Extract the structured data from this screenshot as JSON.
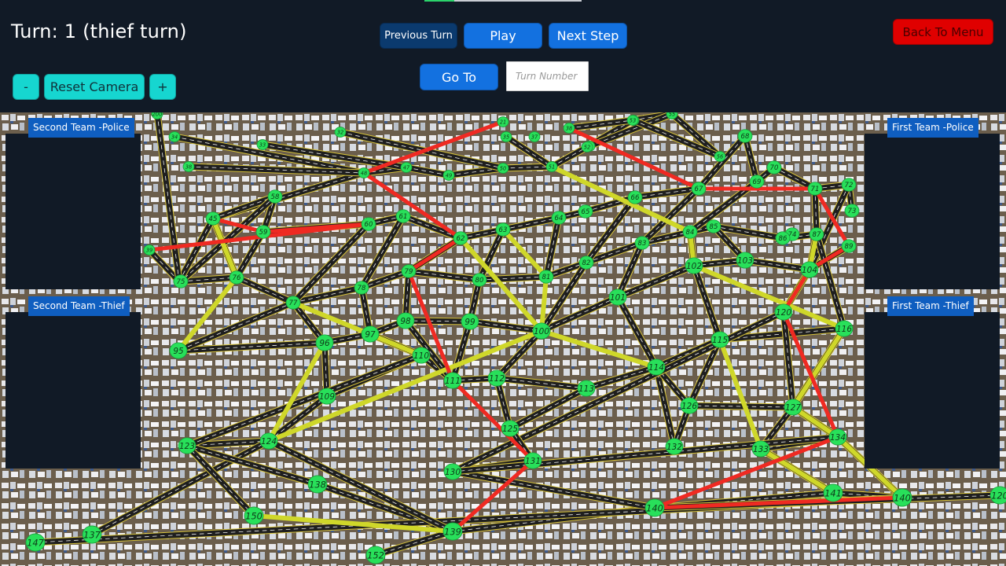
{
  "header": {
    "turn_text": "Turn: 1 (thief turn)",
    "previous_turn_label": "Previous Turn",
    "play_label": "Play",
    "next_step_label": "Next Step",
    "back_to_menu_label": "Back To Menu",
    "go_to_label": "Go To",
    "turn_input_placeholder": "Turn Number",
    "turn_input_value": ""
  },
  "camera": {
    "zoom_out_label": "-",
    "reset_label": "Reset Camera",
    "zoom_in_label": "+"
  },
  "panels": {
    "second_team_police": "Second Team -Police",
    "second_team_thief": "Second Team -Thief",
    "first_team_police": "First Team -Police",
    "first_team_thief": "First Team -Thief"
  },
  "colors": {
    "background": "#111a26",
    "button_blue": "#1371e0",
    "button_teal": "#16d6d0",
    "button_red": "#e00000",
    "node_green": "#28e05a",
    "road_dark": "#1f1f1f",
    "road_yellow": "#cfd72a",
    "road_red": "#ef2a22",
    "ground": "#6b5e4c"
  },
  "map": {
    "nodes": [
      {
        "id": "200"
      },
      {
        "id": "34"
      },
      {
        "id": "38"
      },
      {
        "id": "33"
      },
      {
        "id": "32"
      },
      {
        "id": "21"
      },
      {
        "id": "35"
      },
      {
        "id": "37"
      },
      {
        "id": "38"
      },
      {
        "id": "39"
      },
      {
        "id": "41"
      },
      {
        "id": "39"
      },
      {
        "id": "42"
      },
      {
        "id": "48"
      },
      {
        "id": "47"
      },
      {
        "id": "49"
      },
      {
        "id": "50"
      },
      {
        "id": "51"
      },
      {
        "id": "52"
      },
      {
        "id": "53"
      },
      {
        "id": "55"
      },
      {
        "id": "56"
      },
      {
        "id": "45"
      },
      {
        "id": "58"
      },
      {
        "id": "59"
      },
      {
        "id": "60"
      },
      {
        "id": "61"
      },
      {
        "id": "62"
      },
      {
        "id": "63"
      },
      {
        "id": "64"
      },
      {
        "id": "65"
      },
      {
        "id": "66"
      },
      {
        "id": "67"
      },
      {
        "id": "68"
      },
      {
        "id": "69"
      },
      {
        "id": "70"
      },
      {
        "id": "71"
      },
      {
        "id": "72"
      },
      {
        "id": "73"
      },
      {
        "id": "74"
      },
      {
        "id": "75"
      },
      {
        "id": "76"
      },
      {
        "id": "77"
      },
      {
        "id": "78"
      },
      {
        "id": "79"
      },
      {
        "id": "80"
      },
      {
        "id": "81"
      },
      {
        "id": "82"
      },
      {
        "id": "83"
      },
      {
        "id": "84"
      },
      {
        "id": "85"
      },
      {
        "id": "86"
      },
      {
        "id": "87"
      },
      {
        "id": "88"
      },
      {
        "id": "89"
      },
      {
        "id": "95"
      },
      {
        "id": "96"
      },
      {
        "id": "97"
      },
      {
        "id": "98"
      },
      {
        "id": "99"
      },
      {
        "id": "100"
      },
      {
        "id": "101"
      },
      {
        "id": "102"
      },
      {
        "id": "103"
      },
      {
        "id": "104"
      },
      {
        "id": "109"
      },
      {
        "id": "110"
      },
      {
        "id": "111"
      },
      {
        "id": "112"
      },
      {
        "id": "113"
      },
      {
        "id": "114"
      },
      {
        "id": "115"
      },
      {
        "id": "116"
      },
      {
        "id": "120"
      },
      {
        "id": "123"
      },
      {
        "id": "124"
      },
      {
        "id": "125"
      },
      {
        "id": "126"
      },
      {
        "id": "127"
      },
      {
        "id": "130"
      },
      {
        "id": "131"
      },
      {
        "id": "132"
      },
      {
        "id": "133"
      },
      {
        "id": "134"
      },
      {
        "id": "137"
      },
      {
        "id": "138"
      },
      {
        "id": "139"
      },
      {
        "id": "140"
      },
      {
        "id": "141"
      },
      {
        "id": "142"
      },
      {
        "id": "147"
      },
      {
        "id": "150"
      },
      {
        "id": "152"
      },
      {
        "id": "120"
      },
      {
        "id": "140"
      }
    ],
    "edges": [
      {
        "a": 22,
        "b": 13,
        "kind": "road"
      },
      {
        "a": 13,
        "b": 14,
        "kind": "road"
      },
      {
        "a": 14,
        "b": 15,
        "kind": "road"
      },
      {
        "a": 15,
        "b": 16,
        "kind": "road"
      },
      {
        "a": 16,
        "b": 17,
        "kind": "road"
      },
      {
        "a": 17,
        "b": 18,
        "kind": "road"
      },
      {
        "a": 18,
        "b": 19,
        "kind": "road"
      },
      {
        "a": 19,
        "b": 20,
        "kind": "road"
      },
      {
        "a": 20,
        "b": 21,
        "kind": "road"
      },
      {
        "a": 22,
        "b": 23,
        "kind": "road"
      },
      {
        "a": 23,
        "b": 24,
        "kind": "road"
      },
      {
        "a": 24,
        "b": 25,
        "kind": "road"
      },
      {
        "a": 25,
        "b": 26,
        "kind": "road"
      },
      {
        "a": 26,
        "b": 27,
        "kind": "road"
      },
      {
        "a": 27,
        "b": 28,
        "kind": "road"
      },
      {
        "a": 28,
        "b": 29,
        "kind": "road"
      },
      {
        "a": 29,
        "b": 30,
        "kind": "road"
      },
      {
        "a": 30,
        "b": 31,
        "kind": "road"
      },
      {
        "a": 31,
        "b": 32,
        "kind": "road"
      },
      {
        "a": 32,
        "b": 33,
        "kind": "road"
      },
      {
        "a": 33,
        "b": 34,
        "kind": "road"
      },
      {
        "a": 34,
        "b": 35,
        "kind": "road"
      },
      {
        "a": 35,
        "b": 36,
        "kind": "road"
      },
      {
        "a": 36,
        "b": 37,
        "kind": "road"
      },
      {
        "a": 37,
        "b": 38,
        "kind": "road"
      },
      {
        "a": 40,
        "b": 41,
        "kind": "road"
      },
      {
        "a": 41,
        "b": 42,
        "kind": "road"
      },
      {
        "a": 42,
        "b": 43,
        "kind": "road"
      },
      {
        "a": 43,
        "b": 44,
        "kind": "road"
      },
      {
        "a": 44,
        "b": 45,
        "kind": "road"
      },
      {
        "a": 45,
        "b": 46,
        "kind": "road"
      },
      {
        "a": 46,
        "b": 47,
        "kind": "road"
      },
      {
        "a": 47,
        "b": 48,
        "kind": "road"
      },
      {
        "a": 48,
        "b": 49,
        "kind": "road"
      },
      {
        "a": 49,
        "b": 50,
        "kind": "road"
      },
      {
        "a": 50,
        "b": 51,
        "kind": "road"
      },
      {
        "a": 51,
        "b": 52,
        "kind": "road"
      },
      {
        "a": 52,
        "b": 53,
        "kind": "road"
      },
      {
        "a": 53,
        "b": 54,
        "kind": "road"
      },
      {
        "a": 55,
        "b": 56,
        "kind": "road"
      },
      {
        "a": 56,
        "b": 57,
        "kind": "road"
      },
      {
        "a": 57,
        "b": 58,
        "kind": "road"
      },
      {
        "a": 58,
        "b": 59,
        "kind": "road"
      },
      {
        "a": 59,
        "b": 60,
        "kind": "road"
      },
      {
        "a": 60,
        "b": 61,
        "kind": "road"
      },
      {
        "a": 61,
        "b": 62,
        "kind": "road"
      },
      {
        "a": 62,
        "b": 63,
        "kind": "road"
      },
      {
        "a": 63,
        "b": 64,
        "kind": "road"
      },
      {
        "a": 65,
        "b": 66,
        "kind": "road"
      },
      {
        "a": 66,
        "b": 67,
        "kind": "road"
      },
      {
        "a": 67,
        "b": 68,
        "kind": "road"
      },
      {
        "a": 68,
        "b": 69,
        "kind": "road"
      },
      {
        "a": 69,
        "b": 70,
        "kind": "road"
      },
      {
        "a": 70,
        "b": 71,
        "kind": "road"
      },
      {
        "a": 71,
        "b": 72,
        "kind": "road"
      },
      {
        "a": 74,
        "b": 75,
        "kind": "road"
      },
      {
        "a": 75,
        "b": 65,
        "kind": "road"
      },
      {
        "a": 76,
        "b": 68,
        "kind": "road"
      },
      {
        "a": 77,
        "b": 78,
        "kind": "road"
      },
      {
        "a": 78,
        "b": 73,
        "kind": "road"
      },
      {
        "a": 79,
        "b": 80,
        "kind": "road"
      },
      {
        "a": 80,
        "b": 76,
        "kind": "road"
      },
      {
        "a": 81,
        "b": 70,
        "kind": "road"
      },
      {
        "a": 82,
        "b": 83,
        "kind": "road"
      },
      {
        "a": 83,
        "b": 78,
        "kind": "road"
      },
      {
        "a": 84,
        "b": 75,
        "kind": "road"
      },
      {
        "a": 85,
        "b": 86,
        "kind": "road"
      },
      {
        "a": 86,
        "b": 87,
        "kind": "road"
      },
      {
        "a": 87,
        "b": 88,
        "kind": "road"
      },
      {
        "a": 88,
        "b": 89,
        "kind": "road"
      },
      {
        "a": 89,
        "b": 90,
        "kind": "road"
      },
      {
        "a": 85,
        "b": 74,
        "kind": "road"
      },
      {
        "a": 86,
        "b": 75,
        "kind": "road"
      },
      {
        "a": 87,
        "b": 79,
        "kind": "road"
      },
      {
        "a": 88,
        "b": 82,
        "kind": "road"
      },
      {
        "a": 89,
        "b": 83,
        "kind": "road"
      },
      {
        "a": 91,
        "b": 74,
        "kind": "road"
      },
      {
        "a": 92,
        "b": 86,
        "kind": "road"
      },
      {
        "a": 93,
        "b": 87,
        "kind": "road"
      },
      {
        "a": 22,
        "b": 41,
        "kind": "road"
      },
      {
        "a": 23,
        "b": 40,
        "kind": "road"
      },
      {
        "a": 24,
        "b": 41,
        "kind": "road"
      },
      {
        "a": 25,
        "b": 42,
        "kind": "road"
      },
      {
        "a": 26,
        "b": 43,
        "kind": "road"
      },
      {
        "a": 27,
        "b": 44,
        "kind": "road"
      },
      {
        "a": 28,
        "b": 45,
        "kind": "road"
      },
      {
        "a": 29,
        "b": 46,
        "kind": "road"
      },
      {
        "a": 31,
        "b": 47,
        "kind": "road"
      },
      {
        "a": 32,
        "b": 48,
        "kind": "road"
      },
      {
        "a": 34,
        "b": 49,
        "kind": "road"
      },
      {
        "a": 36,
        "b": 52,
        "kind": "road"
      },
      {
        "a": 37,
        "b": 53,
        "kind": "road"
      },
      {
        "a": 42,
        "b": 55,
        "kind": "road"
      },
      {
        "a": 42,
        "b": 56,
        "kind": "road"
      },
      {
        "a": 43,
        "b": 57,
        "kind": "road"
      },
      {
        "a": 44,
        "b": 58,
        "kind": "road"
      },
      {
        "a": 45,
        "b": 59,
        "kind": "road"
      },
      {
        "a": 47,
        "b": 60,
        "kind": "road"
      },
      {
        "a": 48,
        "b": 61,
        "kind": "road"
      },
      {
        "a": 49,
        "b": 62,
        "kind": "road"
      },
      {
        "a": 50,
        "b": 63,
        "kind": "road"
      },
      {
        "a": 52,
        "b": 72,
        "kind": "road"
      },
      {
        "a": 56,
        "b": 65,
        "kind": "road"
      },
      {
        "a": 57,
        "b": 66,
        "kind": "road"
      },
      {
        "a": 58,
        "b": 67,
        "kind": "road"
      },
      {
        "a": 59,
        "b": 67,
        "kind": "road"
      },
      {
        "a": 60,
        "b": 68,
        "kind": "road"
      },
      {
        "a": 61,
        "b": 70,
        "kind": "road"
      },
      {
        "a": 62,
        "b": 71,
        "kind": "road"
      },
      {
        "a": 64,
        "b": 73,
        "kind": "road"
      },
      {
        "a": 66,
        "b": 74,
        "kind": "road"
      },
      {
        "a": 69,
        "b": 76,
        "kind": "road"
      },
      {
        "a": 70,
        "b": 77,
        "kind": "road"
      },
      {
        "a": 71,
        "b": 77,
        "kind": "road"
      },
      {
        "a": 72,
        "b": 78,
        "kind": "road"
      },
      {
        "a": 73,
        "b": 79,
        "kind": "road"
      },
      {
        "a": 76,
        "b": 80,
        "kind": "road"
      },
      {
        "a": 77,
        "b": 81,
        "kind": "road"
      },
      {
        "a": 78,
        "b": 82,
        "kind": "road"
      },
      {
        "a": 79,
        "b": 83,
        "kind": "road"
      },
      {
        "a": 1,
        "b": 13,
        "kind": "road"
      },
      {
        "a": 2,
        "b": 13,
        "kind": "road"
      },
      {
        "a": 3,
        "b": 14,
        "kind": "road"
      },
      {
        "a": 4,
        "b": 16,
        "kind": "road"
      },
      {
        "a": 6,
        "b": 17,
        "kind": "road"
      },
      {
        "a": 8,
        "b": 19,
        "kind": "road"
      },
      {
        "a": 9,
        "b": 20,
        "kind": "road"
      },
      {
        "a": 10,
        "b": 21,
        "kind": "road"
      },
      {
        "a": 11,
        "b": 12,
        "kind": "road"
      },
      {
        "a": 12,
        "b": 22,
        "kind": "road"
      },
      {
        "a": 0,
        "b": 12,
        "kind": "road"
      },
      {
        "a": 22,
        "b": 41,
        "kind": "yellow"
      },
      {
        "a": 41,
        "b": 55,
        "kind": "yellow"
      },
      {
        "a": 42,
        "b": 66,
        "kind": "yellow"
      },
      {
        "a": 27,
        "b": 60,
        "kind": "yellow"
      },
      {
        "a": 28,
        "b": 46,
        "kind": "yellow"
      },
      {
        "a": 46,
        "b": 60,
        "kind": "yellow"
      },
      {
        "a": 60,
        "b": 70,
        "kind": "yellow"
      },
      {
        "a": 75,
        "b": 60,
        "kind": "yellow"
      },
      {
        "a": 17,
        "b": 49,
        "kind": "yellow"
      },
      {
        "a": 49,
        "b": 62,
        "kind": "yellow"
      },
      {
        "a": 62,
        "b": 72,
        "kind": "yellow"
      },
      {
        "a": 72,
        "b": 78,
        "kind": "yellow"
      },
      {
        "a": 82,
        "b": 88,
        "kind": "yellow"
      },
      {
        "a": 71,
        "b": 82,
        "kind": "yellow"
      },
      {
        "a": 78,
        "b": 83,
        "kind": "yellow"
      },
      {
        "a": 83,
        "b": 89,
        "kind": "yellow"
      },
      {
        "a": 91,
        "b": 86,
        "kind": "yellow"
      },
      {
        "a": 56,
        "b": 75,
        "kind": "yellow"
      },
      {
        "a": 52,
        "b": 64,
        "kind": "yellow"
      },
      {
        "a": 64,
        "b": 73,
        "kind": "yellow"
      },
      {
        "a": 11,
        "b": 25,
        "kind": "red"
      },
      {
        "a": 25,
        "b": 24,
        "kind": "red"
      },
      {
        "a": 24,
        "b": 22,
        "kind": "red"
      },
      {
        "a": 5,
        "b": 13,
        "kind": "red"
      },
      {
        "a": 13,
        "b": 27,
        "kind": "red"
      },
      {
        "a": 27,
        "b": 44,
        "kind": "red"
      },
      {
        "a": 44,
        "b": 67,
        "kind": "red"
      },
      {
        "a": 67,
        "b": 80,
        "kind": "red"
      },
      {
        "a": 80,
        "b": 86,
        "kind": "red"
      },
      {
        "a": 8,
        "b": 32,
        "kind": "red"
      },
      {
        "a": 32,
        "b": 36,
        "kind": "red"
      },
      {
        "a": 36,
        "b": 54,
        "kind": "red"
      },
      {
        "a": 54,
        "b": 53,
        "kind": "red"
      },
      {
        "a": 53,
        "b": 64,
        "kind": "red"
      },
      {
        "a": 64,
        "b": 73,
        "kind": "red"
      },
      {
        "a": 73,
        "b": 83,
        "kind": "red"
      },
      {
        "a": 83,
        "b": 87,
        "kind": "red"
      },
      {
        "a": 87,
        "b": 94,
        "kind": "red"
      }
    ]
  }
}
